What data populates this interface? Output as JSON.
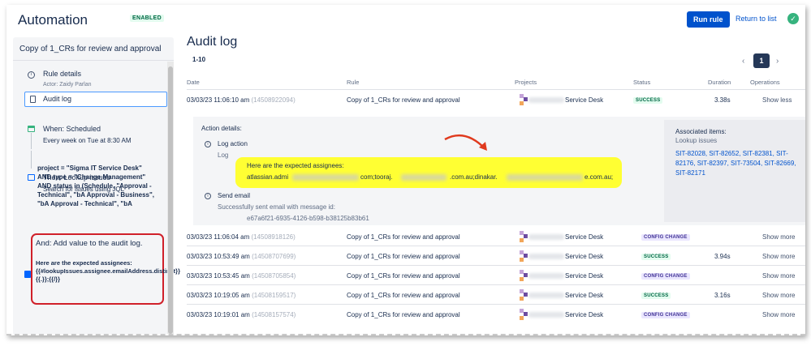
{
  "header": {
    "app_title": "Automation",
    "status_badge": "ENABLED",
    "run_rule": "Run rule",
    "return_to_list": "Return to list"
  },
  "sidebar": {
    "rule_name": "Copy of 1_CRs for review and approval",
    "rule_details": "Rule details",
    "actor": "Actor: Zaidy Parlan",
    "audit_log": "Audit log",
    "when_title": "When: Scheduled",
    "when_sub": "Every week on Tue at 8:30 AM",
    "then_title": "Then: Lookup issues",
    "then_sub": "Search for issues using JQL",
    "jql_lines": [
      "project = \"Sigma IT Service Desk\"",
      "AND type = \"Change Management\"",
      "AND status in (Schedule, \"Approval -",
      "Technical\", \"bA Approval - Business\",",
      "\"bA Approval - Technical\", \"bA"
    ],
    "and_title": "And: Add value to the audit log.",
    "and_body": "Here are the expected assignees: {{#lookupIssues.assignee.emailAddress.distinct}}{{.}};{{/}}"
  },
  "main": {
    "title": "Audit log",
    "range": "1-10",
    "page": "1",
    "columns": [
      "Date",
      "Rule",
      "Projects",
      "Status",
      "Duration",
      "Operations"
    ],
    "rows": [
      {
        "date": "03/03/23 11:06:10 am",
        "id": "(14508922094)",
        "rule": "Copy of 1_CRs for review and approval",
        "project": "Service Desk",
        "status": "SUCCESS",
        "status_kind": "success",
        "duration": "3.38s",
        "op": "Show less"
      },
      {
        "date": "03/03/23 11:06:04 am",
        "id": "(14508918126)",
        "rule": "Copy of 1_CRs for review and approval",
        "project": "Service Desk",
        "status": "CONFIG CHANGE",
        "status_kind": "config",
        "duration": "",
        "op": "Show more"
      },
      {
        "date": "03/03/23 10:53:49 am",
        "id": "(14508707699)",
        "rule": "Copy of 1_CRs for review and approval",
        "project": "Service Desk",
        "status": "SUCCESS",
        "status_kind": "success",
        "duration": "3.94s",
        "op": "Show more"
      },
      {
        "date": "03/03/23 10:53:45 am",
        "id": "(14508705854)",
        "rule": "Copy of 1_CRs for review and approval",
        "project": "Service Desk",
        "status": "CONFIG CHANGE",
        "status_kind": "config",
        "duration": "",
        "op": "Show more"
      },
      {
        "date": "03/03/23 10:19:05 am",
        "id": "(14508159517)",
        "rule": "Copy of 1_CRs for review and approval",
        "project": "Service Desk",
        "status": "SUCCESS",
        "status_kind": "success",
        "duration": "3.16s",
        "op": "Show more"
      },
      {
        "date": "03/03/23 10:19:01 am",
        "id": "(14508157574)",
        "rule": "Copy of 1_CRs for review and approval",
        "project": "Service Desk",
        "status": "CONFIG CHANGE",
        "status_kind": "config",
        "duration": "",
        "op": "Show more"
      }
    ],
    "details": {
      "heading": "Action details:",
      "log_action": "Log action",
      "log_sub": "Log",
      "assignees_label": "Here are the expected assignees:",
      "email_parts": [
        "atlassian.admi",
        "com;tooraj.",
        ".com.au;dinakar.",
        "e.com.au;"
      ],
      "send_email": "Send email",
      "send_sub": "Successfully sent email with message id:",
      "message_id": "e67a6f21-6935-4126-b598-b38125b83b61",
      "assoc_title": "Associated items:",
      "assoc_sub": "Lookup issues",
      "assoc_items": "SIT-82028, SIT-82652, SIT-82381, SIT-82176, SIT-82397, SIT-73504, SIT-82669, SIT-82171"
    }
  },
  "colors": {
    "primary": "#0052cc",
    "success_bg": "#e3fcef",
    "config_bg": "#eae6ff",
    "highlight": "#ffff33",
    "callout_border": "#d0202a"
  }
}
